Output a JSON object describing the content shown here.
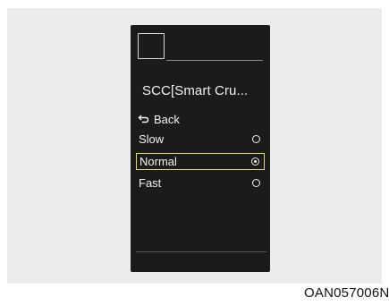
{
  "screen": {
    "title": "SCC[Smart Cru...",
    "back_label": "Back",
    "options": [
      {
        "label": "Slow",
        "selected": false
      },
      {
        "label": "Normal",
        "selected": true
      },
      {
        "label": "Fast",
        "selected": false
      }
    ]
  },
  "figure_code": "OAN057006N",
  "colors": {
    "screen_bg": "#1b1b1b",
    "selection_border": "#e6d36a",
    "panel_bg": "#ececec"
  },
  "icons": {
    "back": "back-arrow-icon",
    "radio": "radio-button-icon",
    "top": "square-icon"
  }
}
